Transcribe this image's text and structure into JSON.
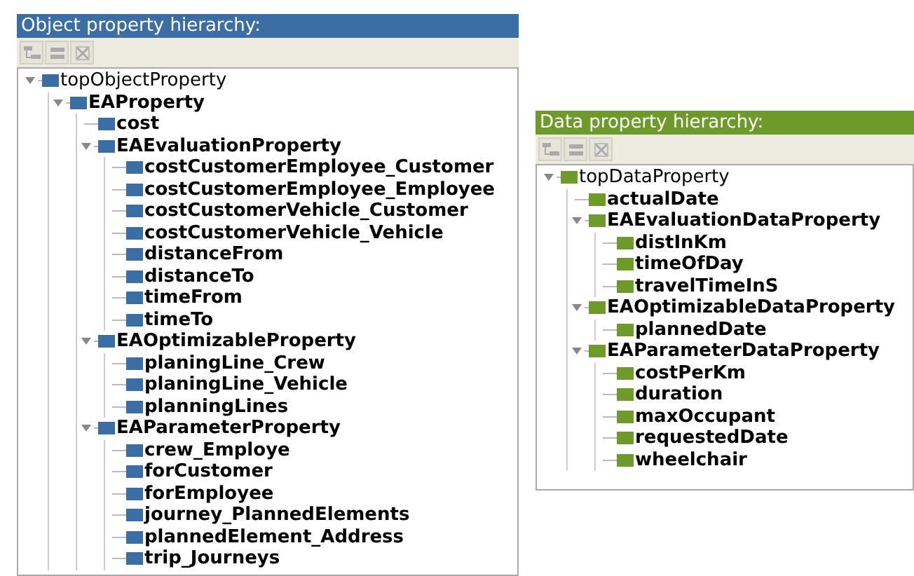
{
  "panels": [
    {
      "kind": "object",
      "title": "Object property hierarchy:",
      "tree": [
        {
          "label": "topObjectProperty",
          "expanded": true,
          "children": [
            {
              "label": "EAProperty",
              "expanded": true,
              "children": [
                {
                  "label": "cost"
                },
                {
                  "label": "EAEvaluationProperty",
                  "expanded": true,
                  "children": [
                    {
                      "label": "costCustomerEmployee_Customer"
                    },
                    {
                      "label": "costCustomerEmployee_Employee"
                    },
                    {
                      "label": "costCustomerVehicle_Customer"
                    },
                    {
                      "label": "costCustomerVehicle_Vehicle"
                    },
                    {
                      "label": "distanceFrom"
                    },
                    {
                      "label": "distanceTo"
                    },
                    {
                      "label": "timeFrom"
                    },
                    {
                      "label": "timeTo"
                    }
                  ]
                },
                {
                  "label": "EAOptimizableProperty",
                  "expanded": true,
                  "children": [
                    {
                      "label": "planingLine_Crew"
                    },
                    {
                      "label": "planingLine_Vehicle"
                    },
                    {
                      "label": "planningLines"
                    }
                  ]
                },
                {
                  "label": "EAParameterProperty",
                  "expanded": true,
                  "children": [
                    {
                      "label": "crew_Employe"
                    },
                    {
                      "label": "forCustomer"
                    },
                    {
                      "label": "forEmployee"
                    },
                    {
                      "label": "journey_PlannedElements"
                    },
                    {
                      "label": "plannedElement_Address"
                    },
                    {
                      "label": "trip_Journeys"
                    }
                  ]
                }
              ]
            }
          ]
        }
      ]
    },
    {
      "kind": "data",
      "title": "Data property hierarchy:",
      "tree": [
        {
          "label": "topDataProperty",
          "expanded": true,
          "children": [
            {
              "label": "actualDate"
            },
            {
              "label": "EAEvaluationDataProperty",
              "expanded": true,
              "children": [
                {
                  "label": "distInKm"
                },
                {
                  "label": "timeOfDay"
                },
                {
                  "label": "travelTimeInS"
                }
              ]
            },
            {
              "label": "EAOptimizableDataProperty",
              "expanded": true,
              "children": [
                {
                  "label": "plannedDate"
                }
              ]
            },
            {
              "label": "EAParameterDataProperty",
              "expanded": true,
              "children": [
                {
                  "label": "costPerKm"
                },
                {
                  "label": "duration"
                },
                {
                  "label": "maxOccupant"
                },
                {
                  "label": "requestedDate"
                },
                {
                  "label": "wheelchair"
                }
              ]
            }
          ]
        }
      ]
    }
  ]
}
